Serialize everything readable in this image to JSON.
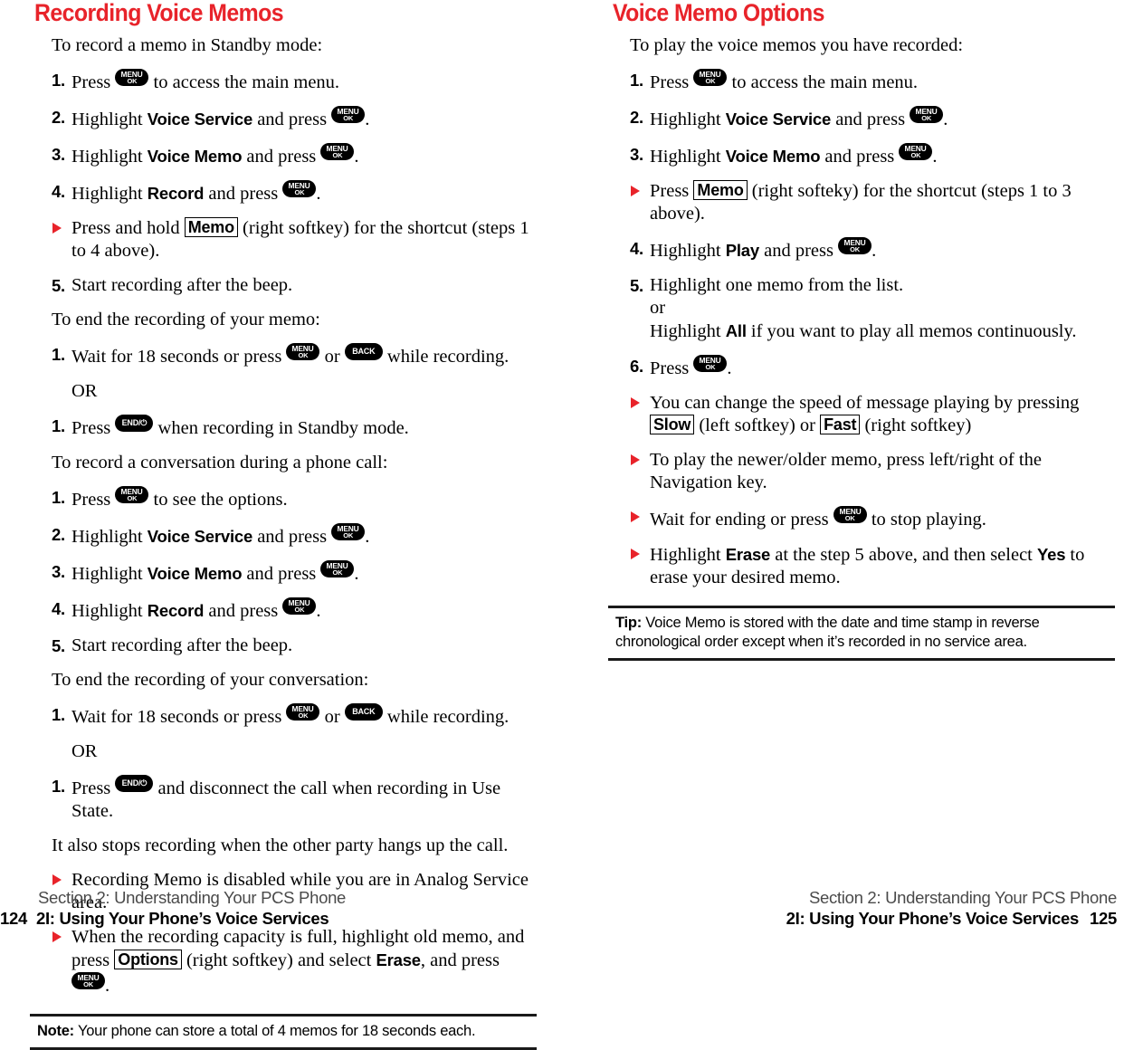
{
  "left_column": {
    "heading": "Recording Voice Memos",
    "blocks": [
      {
        "type": "lead",
        "text": "To record a memo in Standby mode:"
      },
      {
        "type": "step",
        "marker": "1.",
        "text_1": "Press",
        "key": "MENU/OK",
        "text_2": "to access the main menu."
      },
      {
        "type": "step",
        "marker": "2.",
        "text_1": "Highlight",
        "bold": "Voice Service",
        "text_2": "and press",
        "key": "MENU/OK",
        "text_3": "."
      },
      {
        "type": "step",
        "marker": "3.",
        "text_1": "Highlight",
        "bold": "Voice Memo",
        "text_2": "and press",
        "key": "MENU/OK",
        "text_3": "."
      },
      {
        "type": "step",
        "marker": "4.",
        "text_1": "Highlight",
        "bold": "Record",
        "text_2": "and press",
        "key": "MENU/OK",
        "text_3": "."
      },
      {
        "type": "bullet",
        "text_1": "Press and hold",
        "softkey": "Memo",
        "text_2": "(right softkey) for the shortcut (steps 1 to 4 above)."
      },
      {
        "type": "step",
        "marker": "5.",
        "text_1": "Start recording after the beep."
      },
      {
        "type": "lead",
        "text": "To end the recording of your memo:"
      },
      {
        "type": "step",
        "marker": "1.",
        "text_1": "Wait for 18 seconds or press",
        "key": "MENU/OK",
        "text_2": "or",
        "key2": "BACK",
        "text_3": "while recording."
      },
      {
        "type": "or",
        "text": "OR"
      },
      {
        "type": "step",
        "marker": "1.",
        "text_1": "Press",
        "key": "END/⏻",
        "text_2": "when recording in Standby mode."
      },
      {
        "type": "lead",
        "text": "To record a conversation during a phone call:"
      },
      {
        "type": "step",
        "marker": "1.",
        "text_1": "Press",
        "key": "MENU/OK",
        "text_2": "to see the options."
      },
      {
        "type": "step",
        "marker": "2.",
        "text_1": "Highlight",
        "bold": "Voice Service",
        "text_2": "and press",
        "key": "MENU/OK",
        "text_3": "."
      },
      {
        "type": "step",
        "marker": "3.",
        "text_1": "Highlight",
        "bold": "Voice Memo",
        "text_2": "and press",
        "key": "MENU/OK",
        "text_3": "."
      },
      {
        "type": "step",
        "marker": "4.",
        "text_1": "Highlight",
        "bold": "Record",
        "text_2": "and press",
        "key": "MENU/OK",
        "text_3": "."
      },
      {
        "type": "step",
        "marker": "5.",
        "text_1": "Start recording after the beep."
      },
      {
        "type": "lead",
        "text": "To end the recording of your conversation:"
      },
      {
        "type": "step",
        "marker": "1.",
        "text_1": "Wait for 18 seconds or press",
        "key": "MENU/OK",
        "text_2": "or",
        "key2": "BACK",
        "text_3": "while recording."
      },
      {
        "type": "or",
        "text": "OR"
      },
      {
        "type": "step",
        "marker": "1.",
        "text_1": "Press",
        "key": "END/⏻",
        "text_2": "and disconnect the call when recording in Use State."
      },
      {
        "type": "lead",
        "text": "It also stops recording when the other party hangs up the call."
      },
      {
        "type": "bullet",
        "text_1": "Recording Memo is disabled while you are in Analog Service area."
      },
      {
        "type": "bullet",
        "text_1": "When the recording capacity is full, highlight old memo, and press",
        "softkey": "Options",
        "text_2": "(right softkey) and select",
        "bold": "Erase",
        "text_3": ", and press",
        "key": "MENU/OK",
        "text_4": "."
      }
    ],
    "callout": {
      "label": "Note:",
      "text": "Your phone can store a total of 4 memos for 18 seconds each."
    }
  },
  "right_column": {
    "heading": "Voice Memo Options",
    "blocks": [
      {
        "type": "lead",
        "text": "To play the voice memos you have recorded:"
      },
      {
        "type": "step",
        "marker": "1.",
        "text_1": "Press",
        "key": "MENU/OK",
        "text_2": "to access the main menu."
      },
      {
        "type": "step",
        "marker": "2.",
        "text_1": "Highlight",
        "bold": "Voice Service",
        "text_2": "and press",
        "key": "MENU/OK",
        "text_3": "."
      },
      {
        "type": "step",
        "marker": "3.",
        "text_1": "Highlight",
        "bold": "Voice Memo",
        "text_2": "and press",
        "key": "MENU/OK",
        "text_3": "."
      },
      {
        "type": "bullet",
        "text_1": "Press",
        "softkey": "Memo",
        "text_2": "(right softeky) for the shortcut (steps 1 to 3 above)."
      },
      {
        "type": "step",
        "marker": "4.",
        "text_1": "Highlight",
        "bold": "Play",
        "text_2": "and press",
        "key": "MENU/OK",
        "text_3": "."
      },
      {
        "type": "step_multiline",
        "marker": "5.",
        "line1": "Highlight one memo from the list.",
        "line2": "or",
        "line3_1": "Highlight",
        "line3_bold": "All",
        "line3_2": "if you want to play all memos continuously."
      },
      {
        "type": "step",
        "marker": "6.",
        "text_1": "Press",
        "key": "MENU/OK",
        "text_2": "."
      },
      {
        "type": "bullet_softkeys",
        "text_1": "You can change the speed of message playing by pressing",
        "softkey1": "Slow",
        "text_2": "(left softkey) or",
        "softkey2": "Fast",
        "text_3": "(right softkey)"
      },
      {
        "type": "bullet",
        "text_1": "To play the newer/older memo, press left/right of the Navigation key."
      },
      {
        "type": "bullet",
        "text_1": "Wait for ending or press",
        "key": "MENU/OK",
        "text_2": "to stop playing."
      },
      {
        "type": "bullet",
        "text_1": "Highlight",
        "bold": "Erase",
        "text_2": "at the step 5 above, and then select",
        "bold2": "Yes",
        "text_3": "to erase your desired memo."
      }
    ],
    "callout": {
      "label": "Tip:",
      "text": "Voice Memo is stored with the date and time stamp in reverse chronological order except when it’s recorded in no service area."
    }
  },
  "footer_left": {
    "line1": "Section 2: Understanding Your PCS Phone",
    "page_number": "124",
    "line2": "2I: Using Your Phone’s Voice Services"
  },
  "footer_right": {
    "line1": "Section 2: Understanding Your PCS Phone",
    "page_number": "125",
    "line2": "2I: Using Your Phone’s Voice Services"
  },
  "keys": {
    "menu_top": "MENU",
    "menu_bottom": "OK",
    "back": "BACK",
    "end": "END/⏻"
  },
  "colors": {
    "heading_red": "#e8232a",
    "bullet_red": "#e8232a",
    "text_black": "#000000",
    "footer_gray": "#4a4a4a"
  }
}
